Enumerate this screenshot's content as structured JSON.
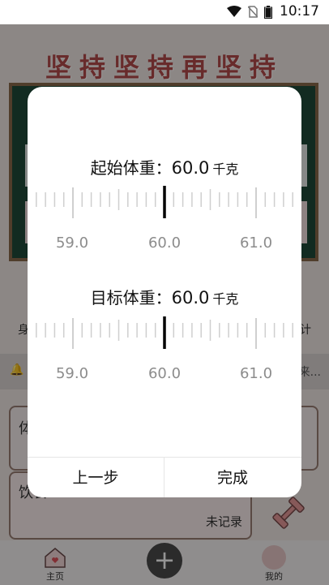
{
  "status_bar": {
    "time": "10:17"
  },
  "background": {
    "banner": "坚持坚持再坚持",
    "left_label": "身",
    "right_label": "计",
    "notice_text": "必来...",
    "card_a_title": "体",
    "card_b_title": "饮食",
    "card_b_status": "未记录",
    "tabs": {
      "home": "主页",
      "me": "我的"
    }
  },
  "dialog": {
    "start_weight": {
      "label": "起始体重：",
      "value": "60.0",
      "unit": "千克",
      "ticks": [
        "59.0",
        "60.0",
        "61.0"
      ]
    },
    "target_weight": {
      "label": "目标体重：",
      "value": "60.0",
      "unit": "千克",
      "ticks": [
        "59.0",
        "60.0",
        "61.0"
      ]
    },
    "buttons": {
      "prev": "上一步",
      "done": "完成"
    }
  }
}
